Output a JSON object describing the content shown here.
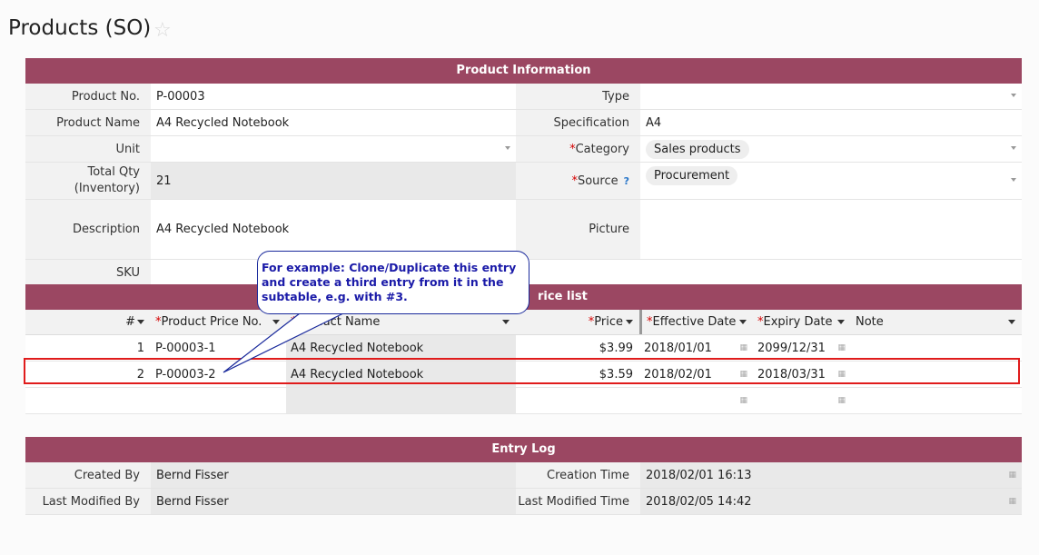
{
  "page": {
    "title": "Products (SO)"
  },
  "product_info": {
    "header": "Product Information",
    "product_no": {
      "label": "Product No.",
      "value": "P-00003"
    },
    "type": {
      "label": "Type",
      "value": ""
    },
    "product_name": {
      "label": "Product Name",
      "value": "A4 Recycled Notebook"
    },
    "specification": {
      "label": "Specification",
      "value": "A4"
    },
    "unit": {
      "label": "Unit",
      "value": ""
    },
    "category": {
      "label": "Category",
      "value": "Sales products"
    },
    "total_qty": {
      "label_line1": "Total Qty",
      "label_line2": "(Inventory)",
      "value": "21"
    },
    "source": {
      "label": "Source",
      "help": "?",
      "value": "Procurement"
    },
    "description": {
      "label": "Description",
      "value": "A4 Recycled Notebook"
    },
    "picture": {
      "label": "Picture"
    },
    "sku": {
      "label": "SKU"
    },
    "required_mark": "*"
  },
  "price_list": {
    "header": "rice list",
    "columns": {
      "num": "#",
      "price_no": "Product Price No.",
      "name": "Product Name",
      "price": "Price",
      "effective": "Effective Date",
      "expiry": "Expiry Date",
      "note": "Note"
    },
    "rows": [
      {
        "num": "1",
        "price_no": "P-00003-1",
        "name": "A4 Recycled Notebook",
        "price": "$3.99",
        "effective": "2018/01/01",
        "expiry": "2099/12/31",
        "note": ""
      },
      {
        "num": "2",
        "price_no": "P-00003-2",
        "name": "A4 Recycled Notebook",
        "price": "$3.59",
        "effective": "2018/02/01",
        "expiry": "2018/03/31",
        "note": ""
      }
    ]
  },
  "callout": {
    "text": "For example: Clone/Duplicate this entry and create a third entry from it in the subtable, e.g. with #3."
  },
  "entry_log": {
    "header": "Entry Log",
    "created_by": {
      "label": "Created By",
      "value": "Bernd Fisser"
    },
    "creation_time": {
      "label": "Creation Time",
      "value": "2018/02/01 16:13"
    },
    "modified_by": {
      "label": "Last Modified By",
      "value": "Bernd Fisser"
    },
    "modified_time": {
      "label": "Last Modified Time",
      "value": "2018/02/05 14:42"
    }
  },
  "colors": {
    "section_bar": "#9b4762",
    "callout_border": "#1a2a9c",
    "highlight": "#e01c1c",
    "required": "#d40000"
  }
}
